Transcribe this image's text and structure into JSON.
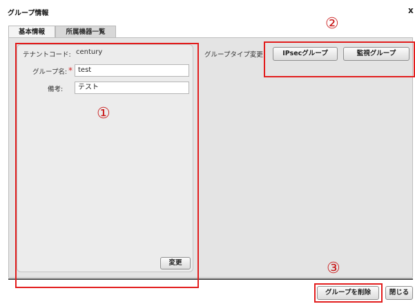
{
  "window": {
    "title": "グループ情報",
    "close": "x"
  },
  "tabs": [
    {
      "label": "基本情報"
    },
    {
      "label": "所属機器一覧"
    }
  ],
  "basic": {
    "tenant_label": "テナントコード:",
    "tenant_value": "century",
    "group_name_label": "グループ名:",
    "required_mark": "*",
    "group_name_value": "test",
    "note_label": "備考:",
    "note_value": "テスト",
    "change_button": "変更"
  },
  "group_type": {
    "label": "グループタイプ変更:",
    "ipsec_button": "IPsecグループ",
    "monitor_button": "監視グループ"
  },
  "footer": {
    "delete_button": "グループを削除",
    "close_button": "閉じる"
  },
  "annotations": {
    "circle1": "①",
    "circle2": "②",
    "circle3": "③",
    "highlight_color": "#e21c1c"
  }
}
